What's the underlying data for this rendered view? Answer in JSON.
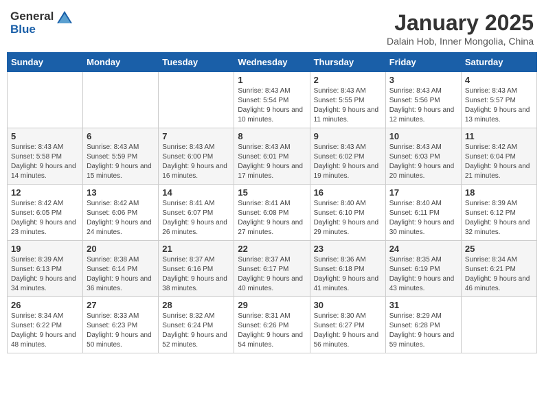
{
  "header": {
    "logo": {
      "general": "General",
      "blue": "Blue"
    },
    "title": "January 2025",
    "subtitle": "Dalain Hob, Inner Mongolia, China"
  },
  "weekdays": [
    "Sunday",
    "Monday",
    "Tuesday",
    "Wednesday",
    "Thursday",
    "Friday",
    "Saturday"
  ],
  "weeks": [
    [
      {
        "day": "",
        "sunrise": "",
        "sunset": "",
        "daylight": ""
      },
      {
        "day": "",
        "sunrise": "",
        "sunset": "",
        "daylight": ""
      },
      {
        "day": "",
        "sunrise": "",
        "sunset": "",
        "daylight": ""
      },
      {
        "day": "1",
        "sunrise": "8:43 AM",
        "sunset": "5:54 PM",
        "daylight": "9 hours and 10 minutes."
      },
      {
        "day": "2",
        "sunrise": "8:43 AM",
        "sunset": "5:55 PM",
        "daylight": "9 hours and 11 minutes."
      },
      {
        "day": "3",
        "sunrise": "8:43 AM",
        "sunset": "5:56 PM",
        "daylight": "9 hours and 12 minutes."
      },
      {
        "day": "4",
        "sunrise": "8:43 AM",
        "sunset": "5:57 PM",
        "daylight": "9 hours and 13 minutes."
      }
    ],
    [
      {
        "day": "5",
        "sunrise": "8:43 AM",
        "sunset": "5:58 PM",
        "daylight": "9 hours and 14 minutes."
      },
      {
        "day": "6",
        "sunrise": "8:43 AM",
        "sunset": "5:59 PM",
        "daylight": "9 hours and 15 minutes."
      },
      {
        "day": "7",
        "sunrise": "8:43 AM",
        "sunset": "6:00 PM",
        "daylight": "9 hours and 16 minutes."
      },
      {
        "day": "8",
        "sunrise": "8:43 AM",
        "sunset": "6:01 PM",
        "daylight": "9 hours and 17 minutes."
      },
      {
        "day": "9",
        "sunrise": "8:43 AM",
        "sunset": "6:02 PM",
        "daylight": "9 hours and 19 minutes."
      },
      {
        "day": "10",
        "sunrise": "8:43 AM",
        "sunset": "6:03 PM",
        "daylight": "9 hours and 20 minutes."
      },
      {
        "day": "11",
        "sunrise": "8:42 AM",
        "sunset": "6:04 PM",
        "daylight": "9 hours and 21 minutes."
      }
    ],
    [
      {
        "day": "12",
        "sunrise": "8:42 AM",
        "sunset": "6:05 PM",
        "daylight": "9 hours and 23 minutes."
      },
      {
        "day": "13",
        "sunrise": "8:42 AM",
        "sunset": "6:06 PM",
        "daylight": "9 hours and 24 minutes."
      },
      {
        "day": "14",
        "sunrise": "8:41 AM",
        "sunset": "6:07 PM",
        "daylight": "9 hours and 26 minutes."
      },
      {
        "day": "15",
        "sunrise": "8:41 AM",
        "sunset": "6:08 PM",
        "daylight": "9 hours and 27 minutes."
      },
      {
        "day": "16",
        "sunrise": "8:40 AM",
        "sunset": "6:10 PM",
        "daylight": "9 hours and 29 minutes."
      },
      {
        "day": "17",
        "sunrise": "8:40 AM",
        "sunset": "6:11 PM",
        "daylight": "9 hours and 30 minutes."
      },
      {
        "day": "18",
        "sunrise": "8:39 AM",
        "sunset": "6:12 PM",
        "daylight": "9 hours and 32 minutes."
      }
    ],
    [
      {
        "day": "19",
        "sunrise": "8:39 AM",
        "sunset": "6:13 PM",
        "daylight": "9 hours and 34 minutes."
      },
      {
        "day": "20",
        "sunrise": "8:38 AM",
        "sunset": "6:14 PM",
        "daylight": "9 hours and 36 minutes."
      },
      {
        "day": "21",
        "sunrise": "8:37 AM",
        "sunset": "6:16 PM",
        "daylight": "9 hours and 38 minutes."
      },
      {
        "day": "22",
        "sunrise": "8:37 AM",
        "sunset": "6:17 PM",
        "daylight": "9 hours and 40 minutes."
      },
      {
        "day": "23",
        "sunrise": "8:36 AM",
        "sunset": "6:18 PM",
        "daylight": "9 hours and 41 minutes."
      },
      {
        "day": "24",
        "sunrise": "8:35 AM",
        "sunset": "6:19 PM",
        "daylight": "9 hours and 43 minutes."
      },
      {
        "day": "25",
        "sunrise": "8:34 AM",
        "sunset": "6:21 PM",
        "daylight": "9 hours and 46 minutes."
      }
    ],
    [
      {
        "day": "26",
        "sunrise": "8:34 AM",
        "sunset": "6:22 PM",
        "daylight": "9 hours and 48 minutes."
      },
      {
        "day": "27",
        "sunrise": "8:33 AM",
        "sunset": "6:23 PM",
        "daylight": "9 hours and 50 minutes."
      },
      {
        "day": "28",
        "sunrise": "8:32 AM",
        "sunset": "6:24 PM",
        "daylight": "9 hours and 52 minutes."
      },
      {
        "day": "29",
        "sunrise": "8:31 AM",
        "sunset": "6:26 PM",
        "daylight": "9 hours and 54 minutes."
      },
      {
        "day": "30",
        "sunrise": "8:30 AM",
        "sunset": "6:27 PM",
        "daylight": "9 hours and 56 minutes."
      },
      {
        "day": "31",
        "sunrise": "8:29 AM",
        "sunset": "6:28 PM",
        "daylight": "9 hours and 59 minutes."
      },
      {
        "day": "",
        "sunrise": "",
        "sunset": "",
        "daylight": ""
      }
    ]
  ],
  "labels": {
    "sunrise": "Sunrise:",
    "sunset": "Sunset:",
    "daylight": "Daylight:"
  }
}
